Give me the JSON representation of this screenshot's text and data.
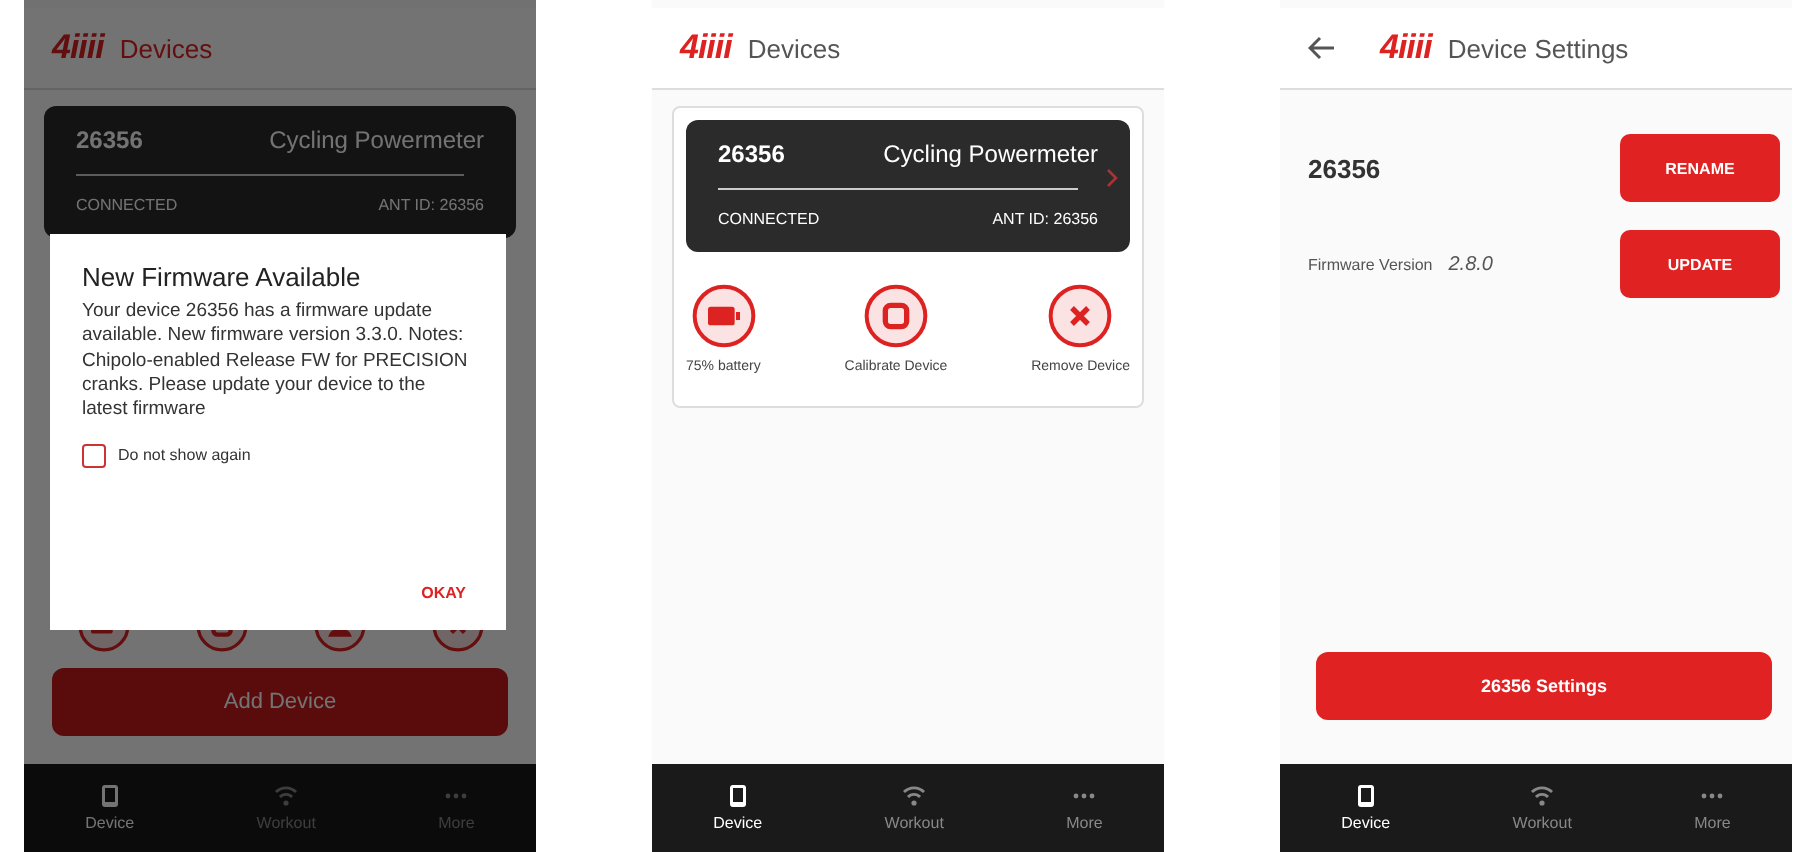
{
  "firmware_dialog_screen": {
    "logo": "4iiii",
    "title": "Devices",
    "device_card": {
      "name": "26356",
      "type": "Cycling Powermeter",
      "status": "CONNECTED",
      "ant_id": "ANT ID: 26356"
    },
    "actions": [
      {
        "kind": "battery"
      },
      {
        "kind": "calibrate"
      },
      {
        "kind": "profile"
      },
      {
        "kind": "remove"
      }
    ],
    "add_button": "Add Device",
    "dialog": {
      "title": "New Firmware Available",
      "message": "Your device 26356 has a firmware update available. New firmware version 3.3.0. Notes: Chipolo-enabled Release FW for PRECISION cranks. Please update your device to the latest firmware",
      "checkbox": {
        "label": "Do not show again",
        "checked": false
      },
      "button": "OKAY"
    },
    "nav": [
      {
        "kind": "device",
        "label": "Device",
        "selected": true
      },
      {
        "kind": "workout",
        "label": "Workout",
        "selected": false
      },
      {
        "kind": "more",
        "label": "More",
        "selected": false
      }
    ]
  },
  "devices_screen": {
    "logo": "4iiii",
    "title": "Devices",
    "device_card": {
      "name": "26356",
      "type": "Cycling Powermeter",
      "status": "CONNECTED",
      "ant_id": "ANT ID: 26356"
    },
    "actions": [
      {
        "kind": "battery",
        "label": "75% battery"
      },
      {
        "kind": "calibrate",
        "label": "Calibrate Device"
      },
      {
        "kind": "remove",
        "label": "Remove Device"
      }
    ],
    "nav": [
      {
        "kind": "device",
        "label": "Device",
        "selected": true
      },
      {
        "kind": "workout",
        "label": "Workout",
        "selected": false
      },
      {
        "kind": "more",
        "label": "More",
        "selected": false
      }
    ]
  },
  "device_settings_screen": {
    "logo": "4iiii",
    "title": "Device Settings",
    "device_name": "26356",
    "rename_button": "RENAME",
    "firmware_label": "Firmware Version",
    "firmware_version": "2.8.0",
    "update_button": "UPDATE",
    "settings_button": "26356 Settings",
    "nav": [
      {
        "kind": "device",
        "label": "Device",
        "selected": true
      },
      {
        "kind": "workout",
        "label": "Workout",
        "selected": false
      },
      {
        "kind": "more",
        "label": "More",
        "selected": false
      }
    ]
  }
}
